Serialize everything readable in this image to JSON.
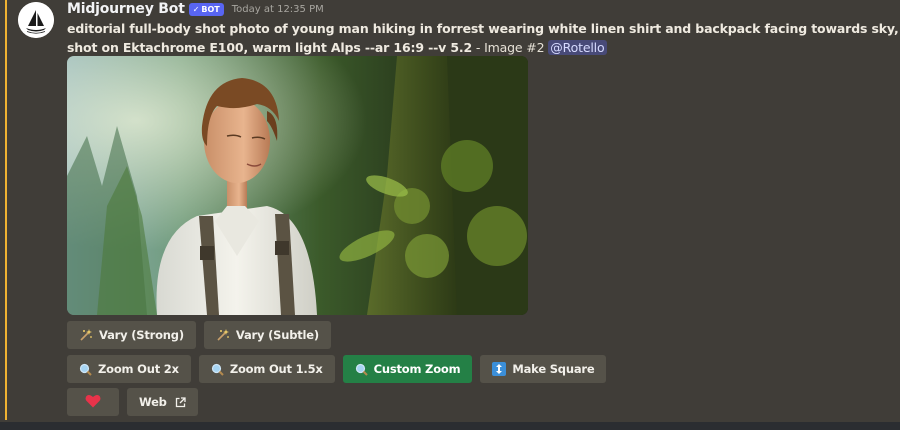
{
  "message": {
    "username": "Midjourney Bot",
    "badge": "BOT",
    "timestamp": "Today at 12:35 PM",
    "prompt_text": "editorial full-body shot photo of young man hiking in forrest wearing white linen shirt and backpack facing towards sky, shot on Ektachrome E100, warm light Alps --ar 16:9 --v 5.2",
    "image_suffix": " - Image #2 ",
    "mention": "@Rotello"
  },
  "buttons": {
    "vary_strong": "Vary (Strong)",
    "vary_subtle": "Vary (Subtle)",
    "zoom_out_2x": "Zoom Out 2x",
    "zoom_out_15x": "Zoom Out 1.5x",
    "custom_zoom": "Custom Zoom",
    "make_square": "Make Square",
    "web": "Web"
  },
  "icons": {
    "vary": "sparkles-icon",
    "zoom": "magnifier-icon",
    "square": "up-down-arrow-icon",
    "favorite": "heart-icon",
    "external": "external-link-icon"
  },
  "colors": {
    "background": "#403d38",
    "highlight": "#f0b232",
    "badge": "#5865f2",
    "button": "#555249",
    "custom_zoom": "#248046",
    "heart": "#e8334a"
  }
}
